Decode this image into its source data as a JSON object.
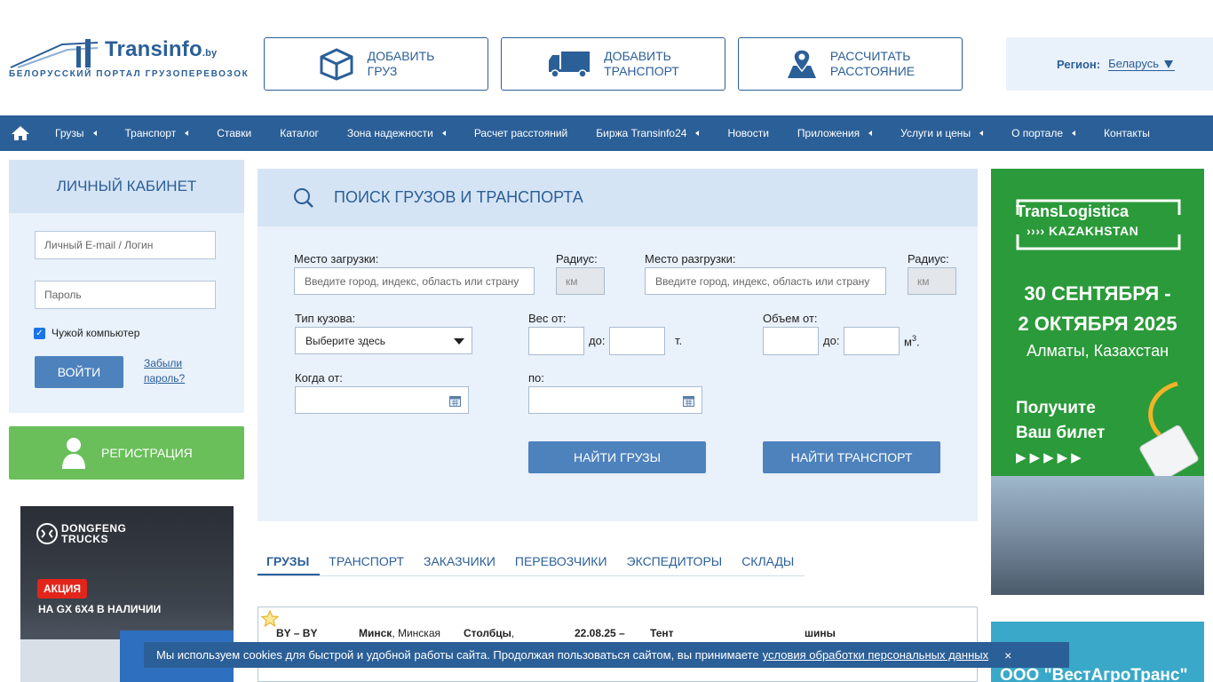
{
  "header": {
    "logo_text": "Transinfo",
    "logo_domain": ".by",
    "logo_subtitle": "БЕЛОРУССКИЙ ПОРТАЛ ГРУЗОПЕРЕВОЗОК",
    "buttons": [
      {
        "line1": "ДОБАВИТЬ",
        "line2": "ГРУЗ",
        "icon": "box-icon"
      },
      {
        "line1": "ДОБАВИТЬ",
        "line2": "ТРАНСПОРТ",
        "icon": "truck-icon"
      },
      {
        "line1": "РАССЧИТАТЬ",
        "line2": "РАССТОЯНИЕ",
        "icon": "map-pin-icon"
      }
    ],
    "region_label": "Регион:",
    "region_value": "Беларусь"
  },
  "nav": {
    "items": [
      {
        "label": "Грузы",
        "has_submenu": true
      },
      {
        "label": "Транспорт",
        "has_submenu": true
      },
      {
        "label": "Ставки",
        "has_submenu": false
      },
      {
        "label": "Каталог",
        "has_submenu": false
      },
      {
        "label": "Зона надежности",
        "has_submenu": true
      },
      {
        "label": "Расчет расстояний",
        "has_submenu": false
      },
      {
        "label": "Биржа Transinfo24",
        "has_submenu": true
      },
      {
        "label": "Новости",
        "has_submenu": false
      },
      {
        "label": "Приложения",
        "has_submenu": true
      },
      {
        "label": "Услуги и цены",
        "has_submenu": true
      },
      {
        "label": "О портале",
        "has_submenu": true
      },
      {
        "label": "Контакты",
        "has_submenu": false
      }
    ]
  },
  "cabinet": {
    "title": "ЛИЧНЫЙ КАБИНЕТ",
    "login_placeholder": "Личный E-mail / Логин",
    "password_placeholder": "Пароль",
    "remember_label": "Чужой компьютер",
    "login_button": "ВОЙТИ",
    "forgot_line1": "Забыли",
    "forgot_line2": "пароль?",
    "register_button": "РЕГИСТРАЦИЯ"
  },
  "ad_left": {
    "brand_line1": "DONGFENG",
    "brand_line2": "TRUCKS",
    "promo": "АКЦИЯ",
    "subtitle": "НА GX 6X4 В НАЛИЧИИ"
  },
  "search": {
    "title": "ПОИСК ГРУЗОВ И ТРАНСПОРТА",
    "load_label": "Место загрузки:",
    "load_placeholder": "Введите город, индекс, область или страну",
    "radius_label": "Радиус:",
    "radius_placeholder": "км",
    "unload_label": "Место разгрузки:",
    "unload_placeholder": "Введите город, индекс, область или страну",
    "body_label": "Тип кузова:",
    "body_value": "Выберите здесь",
    "weight_label": "Вес от:",
    "to_label": "до:",
    "weight_unit": "т.",
    "volume_label": "Объем от:",
    "volume_unit": "м",
    "volume_sup": "3",
    "volume_dot": ".",
    "when_label": "Когда от:",
    "until_label": "по:",
    "find_cargo": "НАЙТИ ГРУЗЫ",
    "find_transport": "НАЙТИ ТРАНСПОРТ"
  },
  "tabs": [
    {
      "label": "ГРУЗЫ",
      "active": true
    },
    {
      "label": "ТРАНСПОРТ",
      "active": false
    },
    {
      "label": "ЗАКАЗЧИКИ",
      "active": false
    },
    {
      "label": "ПЕРЕВОЗЧИКИ",
      "active": false
    },
    {
      "label": "ЭКСПЕДИТОРЫ",
      "active": false
    },
    {
      "label": "СКЛАДЫ",
      "active": false
    }
  ],
  "listing": {
    "route": "BY – BY",
    "from_city": "Минск",
    "from_region": ", Минская",
    "to_city": "Столбцы",
    "to_rest": ",",
    "date": "22.08.25 –",
    "body_type": "Тент",
    "cargo": "шины"
  },
  "ad_right": {
    "line1": "TransLogistica",
    "line2": "›››› KAZAKHSTAN",
    "date_line1": "30 СЕНТЯБРЯ -",
    "date_line2": "2 ОКТЯБРЯ 2025",
    "city": "Алматы, Казахстан",
    "ticket_line1": "Получите",
    "ticket_line2": "Ваш билет",
    "arrows": "▶▶▶▶▶",
    "second_ad": "ООО \"ВестАгроТранс\""
  },
  "cookie": {
    "text": "Мы используем cookies для быстрой и удобной работы сайта. Продолжая пользоваться сайтом, вы принимаете",
    "link": "условия обработки персональных данных",
    "close": "×"
  },
  "colors": {
    "brand_blue": "#2b5f97",
    "button_blue": "#4d82bd",
    "panel_bg": "#e9f1fb",
    "register_green": "#6abf5a"
  }
}
